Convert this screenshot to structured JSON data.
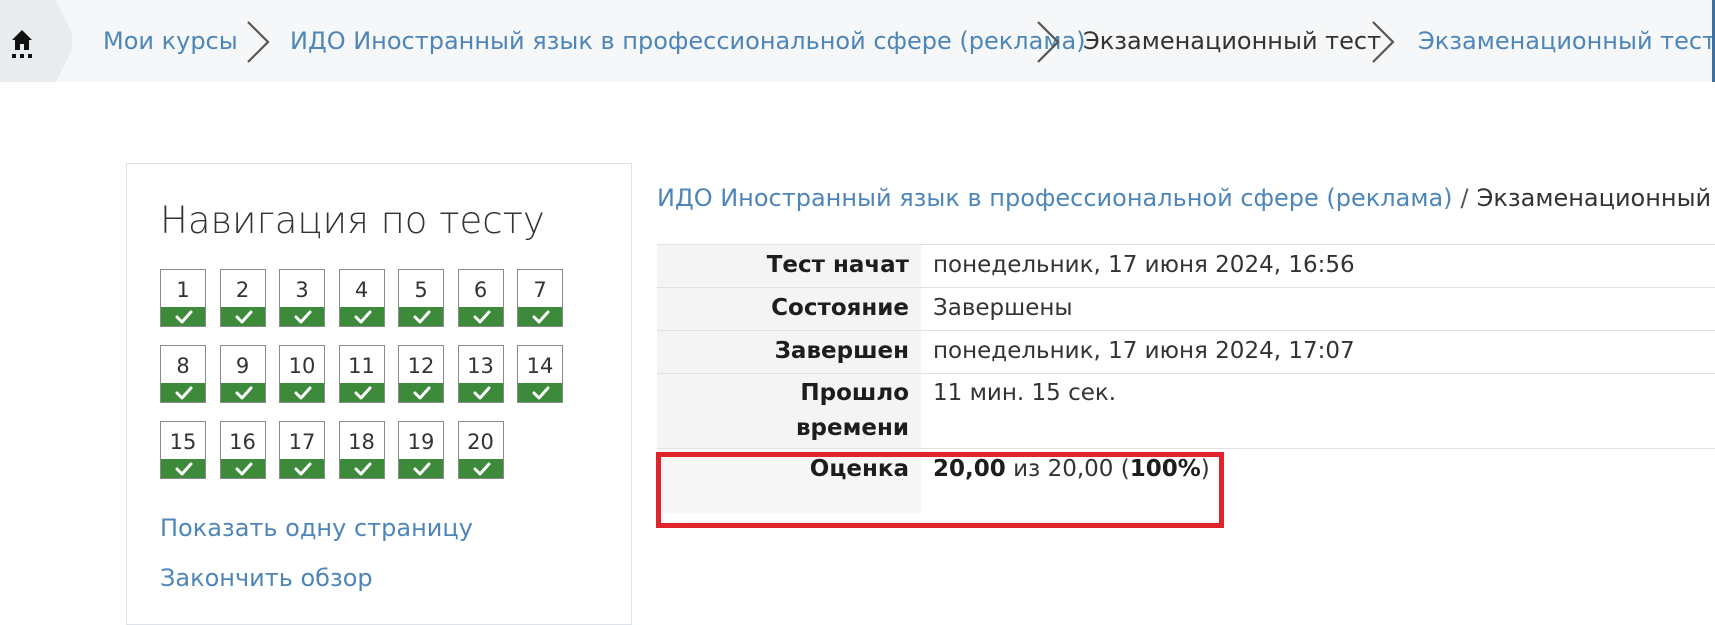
{
  "breadcrumb": {
    "items": [
      {
        "label": "Мои курсы",
        "type": "link"
      },
      {
        "label": "ИДО Иностранный язык в профессиональной сфере (реклама)",
        "type": "link"
      },
      {
        "label": "Экзаменационный тест",
        "type": "current"
      },
      {
        "label": "Экзаменационный тест",
        "type": "link"
      }
    ],
    "home_icon": "home-icon",
    "separator_icon": "chevron-right-icon"
  },
  "navigation": {
    "title": "Навигация по тесту",
    "questions": [
      "1",
      "2",
      "3",
      "4",
      "5",
      "6",
      "7",
      "8",
      "9",
      "10",
      "11",
      "12",
      "13",
      "14",
      "15",
      "16",
      "17",
      "18",
      "19",
      "20"
    ],
    "question_state_icon": "check-icon",
    "state_color": "#3c8a3a",
    "show_one_page": "Показать одну страницу",
    "finish_review": "Закончить обзор"
  },
  "summary": {
    "course_link": "ИДО Иностранный язык в профессиональной сфере (реклама)",
    "separator": "/",
    "current": "Экзаменационный тест",
    "rows": {
      "started": {
        "label": "Тест начат",
        "value": "понедельник, 17 июня 2024, 16:56"
      },
      "state": {
        "label": "Состояние",
        "value": "Завершены"
      },
      "completed": {
        "label": "Завершен",
        "value": "понедельник, 17 июня 2024, 17:07"
      },
      "elapsed": {
        "label_line1": "Прошло",
        "label_line2": "времени",
        "value": "11 мин. 15 сек."
      },
      "grade": {
        "label": "Оценка",
        "value_main": "20,00",
        "value_of": "из 20,00 (",
        "value_pct": "100%",
        "value_end": ")"
      }
    }
  },
  "colors": {
    "link": "#4e86b8",
    "highlight": "#e0242c"
  }
}
